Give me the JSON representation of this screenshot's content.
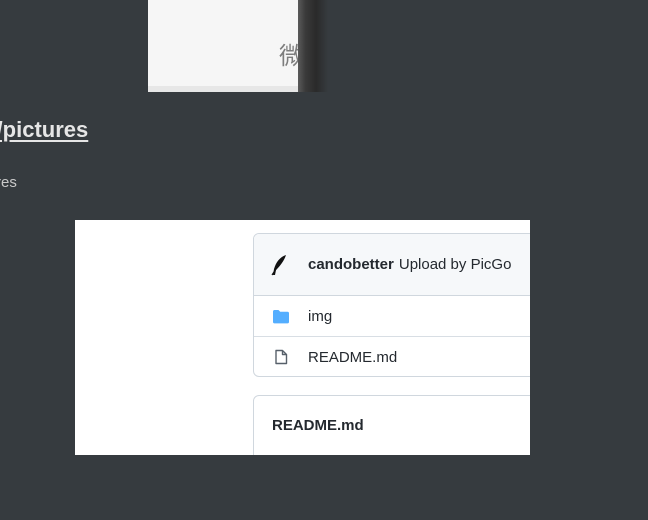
{
  "top_image": {
    "glyph": "微"
  },
  "heading": {
    "text": "r/pictures"
  },
  "subtext": {
    "text": "res"
  },
  "repo": {
    "commit": {
      "author": "candobetter",
      "message": "Upload by PicGo",
      "avatar_icon": "feather-avatar"
    },
    "files": [
      {
        "name": "img",
        "icon": "folder-icon",
        "icon_color": "#54aeff"
      },
      {
        "name": "README.md",
        "icon": "file-icon",
        "icon_color": "#57606a"
      }
    ],
    "readme_title": "README.md"
  },
  "colors": {
    "page_bg": "#363b3f",
    "heading": "#e6e6e6",
    "border": "#d0d7de"
  }
}
